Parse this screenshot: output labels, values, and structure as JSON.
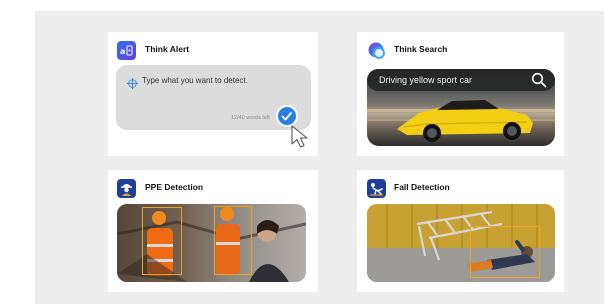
{
  "cards": {
    "think_alert": {
      "title": "Think Alert",
      "icon": "ai-chip-icon",
      "input_placeholder": "Type what you want to detect.",
      "word_counter": "12/40 words left"
    },
    "think_search": {
      "title": "Think Search",
      "icon": "search-orb-icon",
      "search_query": "Driving yellow sport car"
    },
    "ppe_detection": {
      "title": "PPE Detection",
      "icon": "hardhat-worker-icon"
    },
    "fall_detection": {
      "title": "Fall Detection",
      "icon": "falling-person-icon"
    }
  },
  "colors": {
    "panel_bg": "#ededed",
    "card_bg": "#ffffff",
    "accent_blue": "#2a7fe6",
    "icon_navy": "#1f3f9a",
    "detection_box": "#f2a21b",
    "car_yellow": "#f2cf12"
  }
}
